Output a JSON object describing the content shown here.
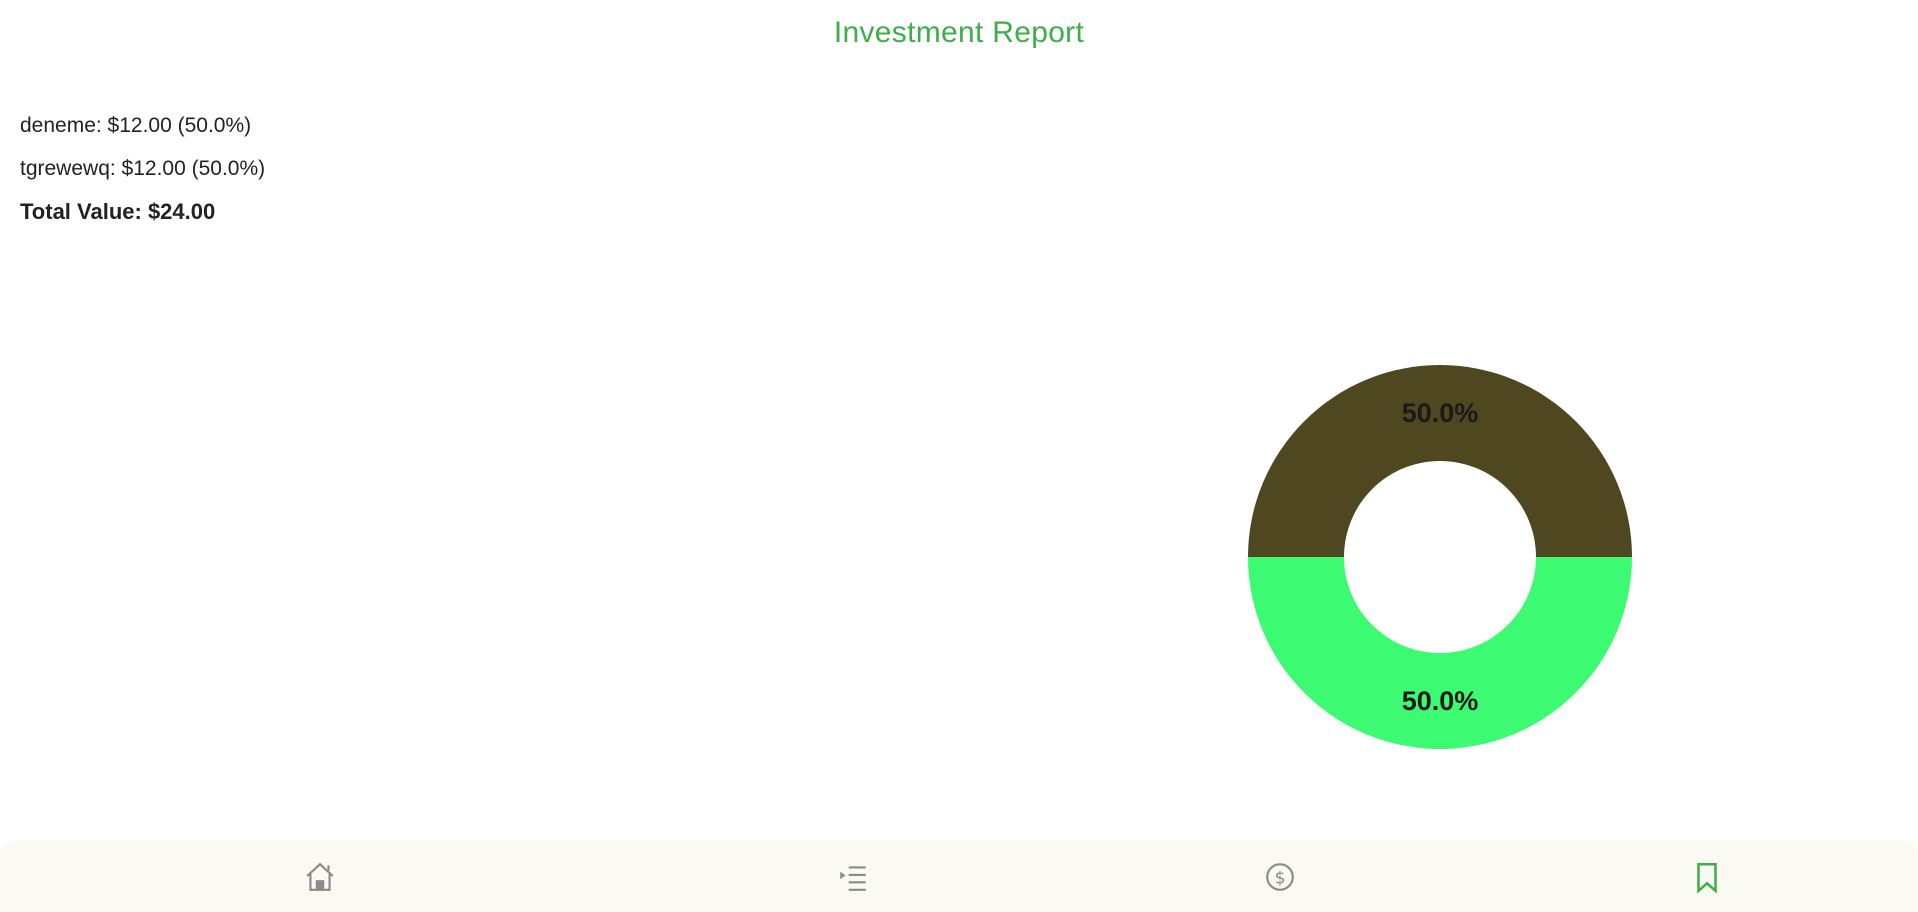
{
  "header": {
    "title": "Investment Report"
  },
  "summary": {
    "lines": [
      "deneme: $12.00 (50.0%)",
      "tgrewewq: $12.00 (50.0%)"
    ],
    "total": "Total Value: $24.00"
  },
  "colors": {
    "accent": "#3fae49",
    "slice_1": "#4e4720",
    "slice_2": "#3cfb72",
    "nav_inactive": "#8a8a8a",
    "nav_active": "#3fae49",
    "nav_bg": "#fafaf3"
  },
  "chart_data": {
    "type": "pie",
    "variant": "donut",
    "slices": [
      {
        "label": "deneme",
        "value": 12.0,
        "percent_label": "50.0%"
      },
      {
        "label": "tgrewewq",
        "value": 12.0,
        "percent_label": "50.0%"
      }
    ],
    "legend": "none"
  },
  "nav": {
    "items": [
      {
        "icon": "home-icon",
        "active": false
      },
      {
        "icon": "list-icon",
        "active": false
      },
      {
        "icon": "dollar-icon",
        "active": false
      },
      {
        "icon": "bookmark-icon",
        "active": true
      }
    ]
  }
}
